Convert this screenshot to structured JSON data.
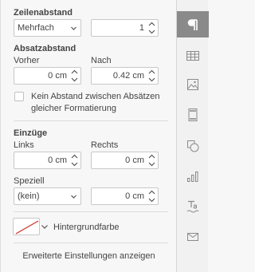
{
  "line_spacing": {
    "title": "Zeilenabstand",
    "type_value": "Mehrfach",
    "amount_value": "1"
  },
  "paragraph_spacing": {
    "title": "Absatzabstand",
    "before_label": "Vorher",
    "after_label": "Nach",
    "before_value": "0 cm",
    "after_value": "0.42 cm",
    "no_spacing_label": "Kein Abstand zwischen Absätzen gleicher Formatierung"
  },
  "indents": {
    "title": "Einzüge",
    "left_label": "Links",
    "right_label": "Rechts",
    "left_value": "0 cm",
    "right_value": "0 cm",
    "special_label": "Speziell",
    "special_value": "(kein)",
    "special_amount_value": "0 cm"
  },
  "background": {
    "label": "Hintergrundfarbe",
    "color": "none"
  },
  "advanced_link": "Erweiterte Einstellungen anzeigen",
  "sidebar": {
    "tabs": [
      "paragraph-icon",
      "table-icon",
      "image-icon",
      "header-footer-icon",
      "shape-icon",
      "chart-icon",
      "text-art-icon",
      "mail-merge-icon"
    ],
    "active": "paragraph-icon"
  }
}
